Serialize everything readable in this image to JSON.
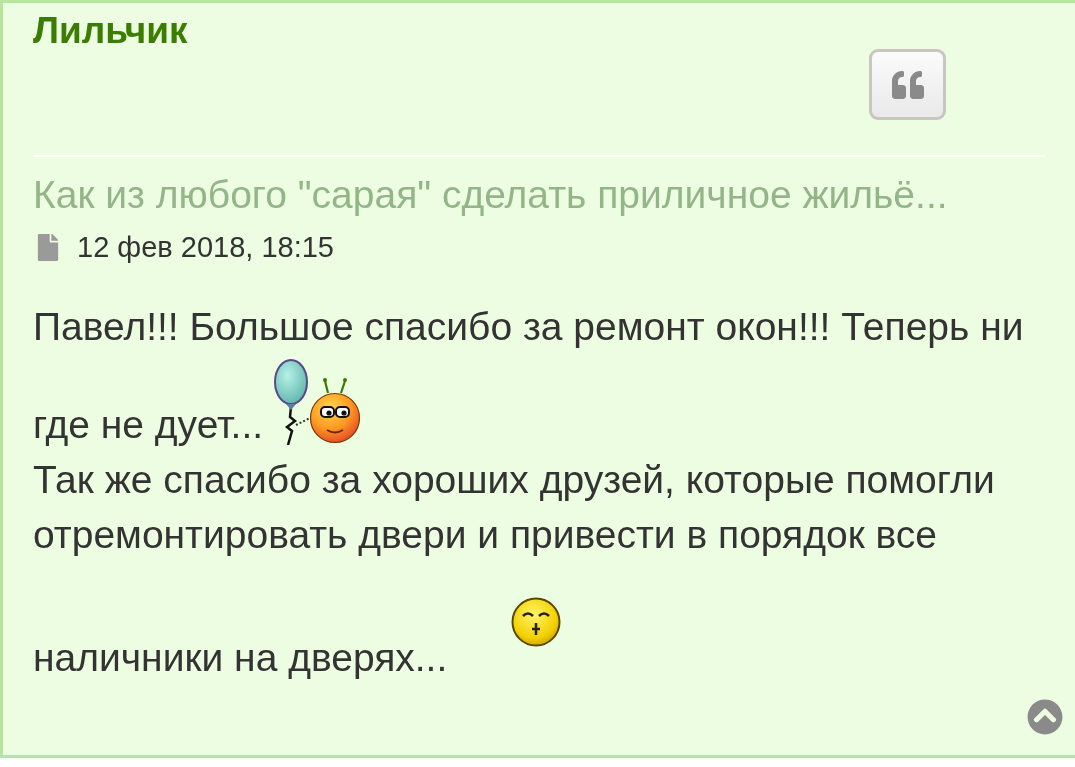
{
  "post": {
    "author": "Лильчик",
    "topic_title": "Как из любого \"сарая\" сделать приличное жильё...",
    "date": "12 фев 2018, 18:15",
    "paragraphs": [
      {
        "lines": [
          "Павел!!! Большое спасибо за ремонт окон!!! Теперь ни",
          "где не дует..."
        ],
        "emoji": {
          "kind": "balloon_smiley"
        }
      },
      {
        "lines": [
          "Так же спасибо за хороших друзей, которые помогли",
          "отремонтировать двери и привести в порядок все",
          "наличники на дверях..."
        ],
        "emoji": {
          "kind": "kiss"
        }
      }
    ]
  }
}
